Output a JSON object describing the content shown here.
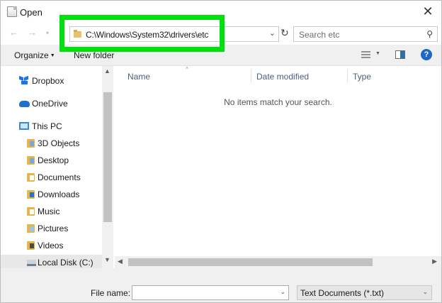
{
  "window": {
    "title": "Open",
    "close_glyph": "✕"
  },
  "nav": {
    "back_glyph": "←",
    "forward_glyph": "→",
    "history_glyph": "▾",
    "address": "C:\\Windows\\System32\\drivers\\etc",
    "address_dropdown_glyph": "⌄",
    "refresh_glyph": "↻",
    "search_placeholder": "Search etc",
    "search_glyph": "⚲"
  },
  "toolbar": {
    "organize": "Organize",
    "organize_caret": "▼",
    "new_folder": "New folder",
    "view_dropdown_glyph": "▼",
    "help_glyph": "?"
  },
  "sidebar": {
    "items": [
      {
        "label": "Dropbox",
        "icon": "dropbox-icon"
      },
      {
        "label": "OneDrive",
        "icon": "onedrive-icon"
      },
      {
        "label": "This PC",
        "icon": "this-pc-icon"
      },
      {
        "label": "3D Objects",
        "icon": "folder-3d-objects-icon"
      },
      {
        "label": "Desktop",
        "icon": "folder-desktop-icon"
      },
      {
        "label": "Documents",
        "icon": "folder-documents-icon"
      },
      {
        "label": "Downloads",
        "icon": "folder-downloads-icon"
      },
      {
        "label": "Music",
        "icon": "folder-music-icon"
      },
      {
        "label": "Pictures",
        "icon": "folder-pictures-icon"
      },
      {
        "label": "Videos",
        "icon": "folder-videos-icon"
      },
      {
        "label": "Local Disk (C:)",
        "icon": "local-disk-icon"
      }
    ],
    "scroll_up_glyph": "▲",
    "scroll_down_glyph": "▼"
  },
  "file_list": {
    "columns": {
      "name": "Name",
      "date_modified": "Date modified",
      "type": "Type"
    },
    "sort_glyph": "^",
    "empty_message": "No items match your search.",
    "scroll_left_glyph": "◀",
    "scroll_right_glyph": "▶"
  },
  "footer": {
    "file_name_label": "File name:",
    "file_name_value": "",
    "file_name_dropdown_glyph": "⌄",
    "file_type": "Text Documents (*.txt)",
    "file_type_dropdown_glyph": "⌄"
  },
  "colors": {
    "highlight": "#00e00f",
    "accent": "#1e66c8"
  }
}
